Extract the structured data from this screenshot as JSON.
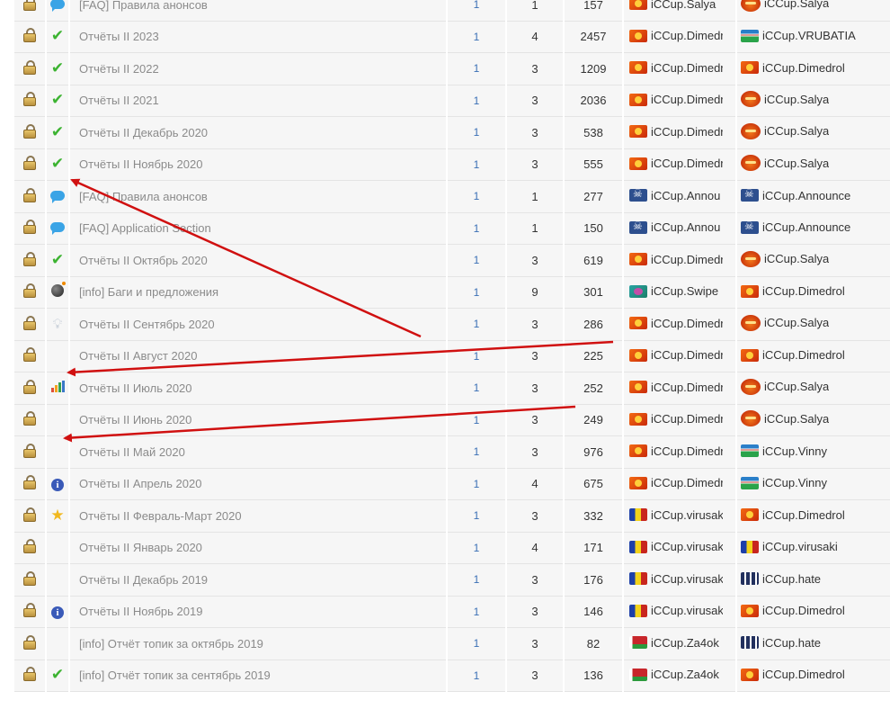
{
  "accent_colors": {
    "pages_link": "#3a6fb5",
    "arrow": "#d01010",
    "check": "#3cb331"
  },
  "rows": [
    {
      "icon": "speech-icon",
      "title": "[FAQ] Правила анонсов",
      "pages": "1",
      "replies": "1",
      "views": "157",
      "author_flag": "fire-flag",
      "author": "iCCup.Salya",
      "last_flag": "devil-flag",
      "last": "iCCup.Salya"
    },
    {
      "icon": "check-icon",
      "title": "Отчёты II 2023",
      "pages": "1",
      "replies": "4",
      "views": "2457",
      "author_flag": "fire-flag",
      "author": "iCCup.Dimedr",
      "last_flag": "uz-flag",
      "last": "iCCup.VRUBATIA"
    },
    {
      "icon": "check-icon",
      "title": "Отчёты II 2022",
      "pages": "1",
      "replies": "3",
      "views": "1209",
      "author_flag": "fire-flag",
      "author": "iCCup.Dimedr",
      "last_flag": "fire-flag",
      "last": "iCCup.Dimedrol"
    },
    {
      "icon": "check-icon",
      "title": "Отчёты II 2021",
      "pages": "1",
      "replies": "3",
      "views": "2036",
      "author_flag": "fire-flag",
      "author": "iCCup.Dimedr",
      "last_flag": "devil-flag",
      "last": "iCCup.Salya"
    },
    {
      "icon": "check-icon",
      "title": "Отчёты II Декабрь 2020",
      "pages": "1",
      "replies": "3",
      "views": "538",
      "author_flag": "fire-flag",
      "author": "iCCup.Dimedr",
      "last_flag": "devil-flag",
      "last": "iCCup.Salya"
    },
    {
      "icon": "check-icon",
      "title": "Отчёты II Ноябрь 2020",
      "pages": "1",
      "replies": "3",
      "views": "555",
      "author_flag": "fire-flag",
      "author": "iCCup.Dimedr",
      "last_flag": "devil-flag",
      "last": "iCCup.Salya"
    },
    {
      "icon": "speech-icon",
      "title": "[FAQ] Правила анонсов",
      "pages": "1",
      "replies": "1",
      "views": "277",
      "author_flag": "pirate-flag",
      "author": "iCCup.Annou",
      "last_flag": "pirate-flag",
      "last": "iCCup.Announce"
    },
    {
      "icon": "speech-icon",
      "title": "[FAQ] Application Section",
      "pages": "1",
      "replies": "1",
      "views": "150",
      "author_flag": "pirate-flag",
      "author": "iCCup.Annou",
      "last_flag": "pirate-flag",
      "last": "iCCup.Announce"
    },
    {
      "icon": "check-icon",
      "title": "Отчёты II Октябрь 2020",
      "pages": "1",
      "replies": "3",
      "views": "619",
      "author_flag": "fire-flag",
      "author": "iCCup.Dimedr",
      "last_flag": "devil-flag",
      "last": "iCCup.Salya"
    },
    {
      "icon": "bomb-icon",
      "title": "[info] Баги и предложения",
      "pages": "1",
      "replies": "9",
      "views": "301",
      "author_flag": "teal-flag",
      "author": "iCCup.Swipe",
      "last_flag": "fire-flag",
      "last": "iCCup.Dimedrol"
    },
    {
      "icon": "lightbulb-icon",
      "title": "Отчёты II Сентябрь 2020",
      "pages": "1",
      "replies": "3",
      "views": "286",
      "author_flag": "fire-flag",
      "author": "iCCup.Dimedr",
      "last_flag": "devil-flag",
      "last": "iCCup.Salya"
    },
    {
      "icon": "",
      "title": "Отчёты II Август 2020",
      "pages": "1",
      "replies": "3",
      "views": "225",
      "author_flag": "fire-flag",
      "author": "iCCup.Dimedr",
      "last_flag": "fire-flag",
      "last": "iCCup.Dimedrol"
    },
    {
      "icon": "bar-chart-icon",
      "title": "Отчёты II Июль 2020",
      "pages": "1",
      "replies": "3",
      "views": "252",
      "author_flag": "fire-flag",
      "author": "iCCup.Dimedr",
      "last_flag": "devil-flag",
      "last": "iCCup.Salya"
    },
    {
      "icon": "",
      "title": "Отчёты II Июнь 2020",
      "pages": "1",
      "replies": "3",
      "views": "249",
      "author_flag": "fire-flag",
      "author": "iCCup.Dimedr",
      "last_flag": "devil-flag",
      "last": "iCCup.Salya"
    },
    {
      "icon": "",
      "title": "Отчёты II Май 2020",
      "pages": "1",
      "replies": "3",
      "views": "976",
      "author_flag": "fire-flag",
      "author": "iCCup.Dimedr",
      "last_flag": "uz-flag",
      "last": "iCCup.Vinny"
    },
    {
      "icon": "info-icon",
      "title": "Отчёты II Апрель 2020",
      "pages": "1",
      "replies": "4",
      "views": "675",
      "author_flag": "fire-flag",
      "author": "iCCup.Dimedr",
      "last_flag": "uz-flag",
      "last": "iCCup.Vinny"
    },
    {
      "icon": "star-icon",
      "title": "Отчёты II Февраль-Март 2020",
      "pages": "1",
      "replies": "3",
      "views": "332",
      "author_flag": "md-flag",
      "author": "iCCup.virusak",
      "last_flag": "fire-flag",
      "last": "iCCup.Dimedrol"
    },
    {
      "icon": "",
      "title": "Отчёты II Январь 2020",
      "pages": "1",
      "replies": "4",
      "views": "171",
      "author_flag": "md-flag",
      "author": "iCCup.virusak",
      "last_flag": "md-flag",
      "last": "iCCup.virusaki"
    },
    {
      "icon": "",
      "title": "Отчёты II Декабрь 2019",
      "pages": "1",
      "replies": "3",
      "views": "176",
      "author_flag": "md-flag",
      "author": "iCCup.virusak",
      "last_flag": "hate-flag",
      "last": "iCCup.hate"
    },
    {
      "icon": "info-icon",
      "title": "Отчёты II Ноябрь 2019",
      "pages": "1",
      "replies": "3",
      "views": "146",
      "author_flag": "md-flag",
      "author": "iCCup.virusak",
      "last_flag": "fire-flag",
      "last": "iCCup.Dimedrol"
    },
    {
      "icon": "",
      "title": "[info] Отчёт топик за октябрь 2019",
      "pages": "1",
      "replies": "3",
      "views": "82",
      "author_flag": "by-flag",
      "author": "iCCup.Za4ok",
      "last_flag": "hate-flag",
      "last": "iCCup.hate"
    },
    {
      "icon": "check-icon",
      "title": "[info] Отчёт топик за сентябрь 2019",
      "pages": "1",
      "replies": "3",
      "views": "136",
      "author_flag": "by-flag",
      "author": "iCCup.Za4ok",
      "last_flag": "fire-flag",
      "last": "iCCup.Dimedrol"
    }
  ]
}
